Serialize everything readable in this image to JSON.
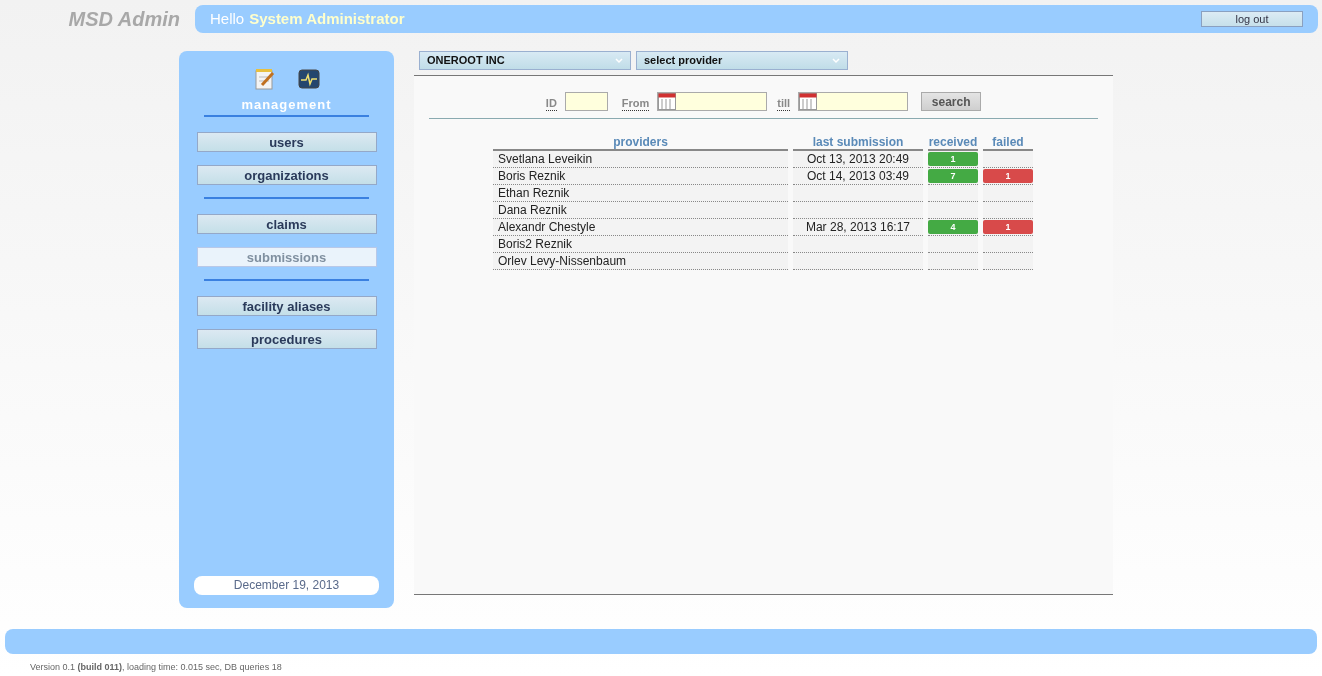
{
  "header": {
    "app_title": "MSD Admin",
    "greeting": "Hello",
    "user_name": "System Administrator",
    "logout_button": "log out"
  },
  "sidebar": {
    "section_label": "management",
    "groups": [
      [
        {
          "label": "users",
          "selected": false
        },
        {
          "label": "organizations",
          "selected": false
        }
      ],
      [
        {
          "label": "claims",
          "selected": false
        },
        {
          "label": "submissions",
          "selected": true
        }
      ],
      [
        {
          "label": "facility aliases",
          "selected": false
        },
        {
          "label": "procedures",
          "selected": false
        }
      ]
    ],
    "date": "December 19, 2013"
  },
  "filters": {
    "organization_select": "ONEROOT INC",
    "provider_select": "select provider",
    "id_label": "ID",
    "from_label": "From",
    "till_label": "till",
    "search_button": "search"
  },
  "table": {
    "columns": [
      "providers",
      "last submission",
      "received",
      "failed"
    ],
    "rows": [
      {
        "provider": "Svetlana Leveikin",
        "last_submission": "Oct 13, 2013 20:49",
        "received": "1"
      },
      {
        "provider": "Boris Reznik",
        "last_submission": "Oct 14, 2013 03:49",
        "received": "7",
        "failed": "1"
      },
      {
        "provider": "Ethan Reznik"
      },
      {
        "provider": "Dana Reznik"
      },
      {
        "provider": "Alexandr Chestyle",
        "last_submission": "Mar 28, 2013 16:17",
        "received": "4",
        "failed": "1"
      },
      {
        "provider": "Boris2 Reznik"
      },
      {
        "provider": "Orlev Levy-Nissenbaum"
      }
    ]
  },
  "footer": {
    "version_text": "Version 0.1 **(build 011)**, loading time: 0.015 sec, DB queries 18"
  }
}
